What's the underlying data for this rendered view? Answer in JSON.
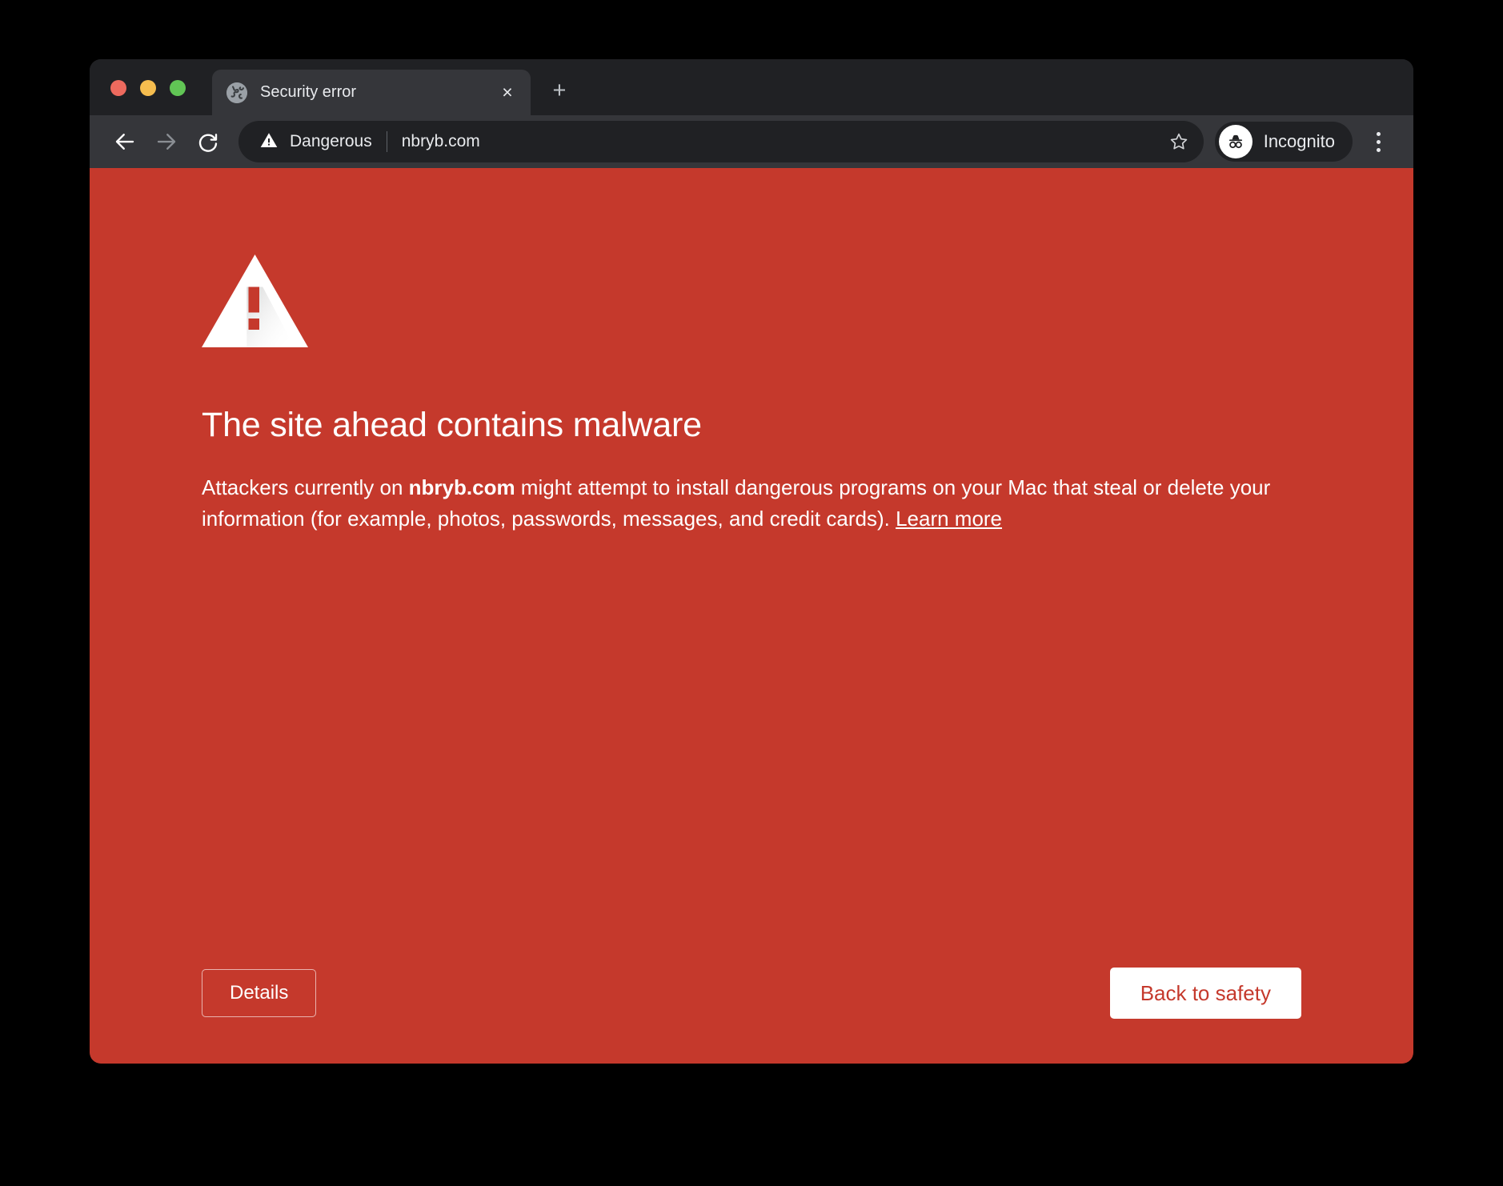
{
  "window": {
    "traffic_lights": [
      {
        "name": "close",
        "color": "#ED6A5E"
      },
      {
        "name": "minimize",
        "color": "#F5BD4F"
      },
      {
        "name": "maximize",
        "color": "#61C555"
      }
    ]
  },
  "tabstrip": {
    "tabs": [
      {
        "title": "Security error",
        "favicon": "globe-icon",
        "close_label": "×",
        "active": true
      }
    ],
    "new_tab_label": "+"
  },
  "toolbar": {
    "back_icon": "back-arrow-icon",
    "forward_icon": "forward-arrow-icon",
    "reload_icon": "reload-icon",
    "omnibox": {
      "security_icon": "dangerous-warning-icon",
      "security_label": "Dangerous",
      "url": "nbryb.com",
      "bookmark_icon": "star-icon"
    },
    "profile": {
      "icon": "incognito-icon",
      "label": "Incognito"
    },
    "menu_icon": "three-dot-menu-icon"
  },
  "interstitial": {
    "icon": "warning-triangle-icon",
    "heading": "The site ahead contains malware",
    "body_part_1": "Attackers currently on ",
    "body_domain": "nbryb.com",
    "body_part_2": " might attempt to install dangerous programs on your Mac that steal or delete your information (for example, photos, passwords, messages, and credit cards). ",
    "learn_more": "Learn more",
    "details_button": "Details",
    "back_to_safety_button": "Back to safety"
  },
  "colors": {
    "page_background": "#C5392C",
    "chrome_toolbar": "#35363A",
    "chrome_tabstrip": "#202124",
    "text_primary": "#E8EAED",
    "button_primary_text": "#C5392C"
  }
}
